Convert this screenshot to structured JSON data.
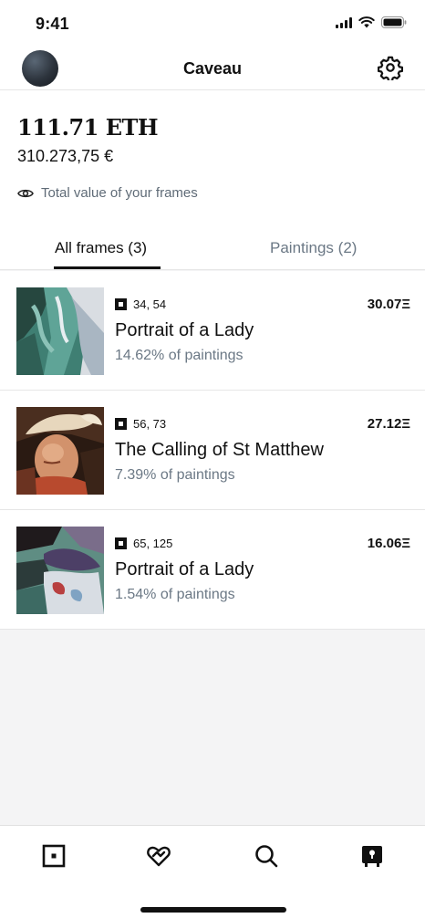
{
  "status_bar": {
    "time": "9:41"
  },
  "header": {
    "title": "Caveau",
    "avatar": "avatar",
    "settings_icon": "gear-icon"
  },
  "balance": {
    "eth": "111.71 ETH",
    "eur": "310.273,75 €",
    "total_label": "Total value of your frames",
    "total_icon": "eye-icon"
  },
  "tabs": [
    {
      "label": "All frames (3)",
      "active": true
    },
    {
      "label": "Paintings (2)",
      "active": false
    }
  ],
  "items": [
    {
      "coords": "34, 54",
      "title": "Portrait of a Lady",
      "pct": "14.62% of paintings",
      "price": "30.07Ξ"
    },
    {
      "coords": "56, 73",
      "title": "The Calling of St Matthew",
      "pct": "7.39% of paintings",
      "price": "27.12Ξ"
    },
    {
      "coords": "65, 125",
      "title": "Portrait of a Lady",
      "pct": "1.54% of paintings",
      "price": "16.06Ξ"
    }
  ],
  "bottom_nav": [
    {
      "icon": "frame-icon"
    },
    {
      "icon": "heart-icon"
    },
    {
      "icon": "search-icon"
    },
    {
      "icon": "vault-icon"
    }
  ],
  "colors": {
    "text": "#111111",
    "muted": "#6b7885",
    "divider": "#e6e6e6",
    "background": "#f4f4f5"
  }
}
